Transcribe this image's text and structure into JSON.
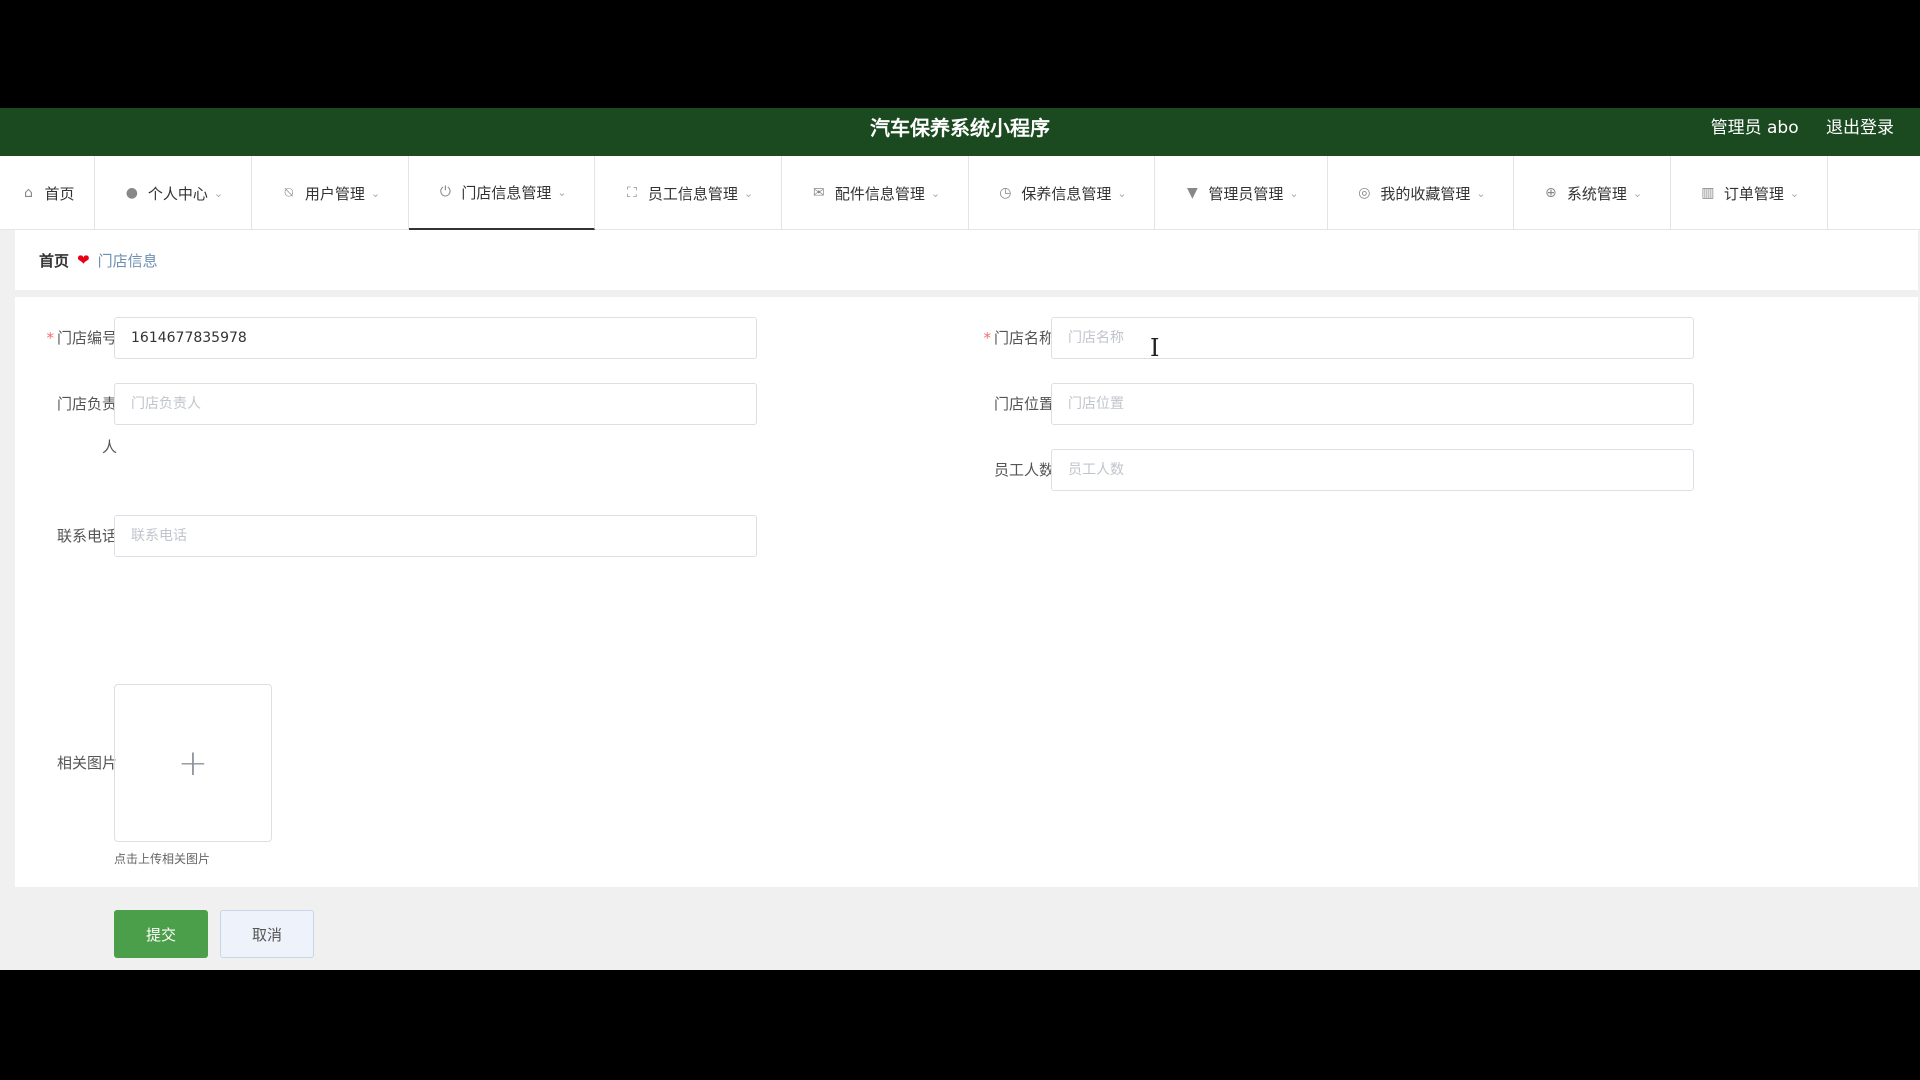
{
  "header": {
    "title": "汽车保养系统小程序",
    "user_label": "管理员 abo",
    "logout_label": "退出登录"
  },
  "nav": {
    "items": [
      {
        "label": "首页",
        "icon": "home-icon",
        "active": false,
        "has_dropdown": false
      },
      {
        "label": "个人中心",
        "icon": "user-icon",
        "active": false,
        "has_dropdown": true
      },
      {
        "label": "用户管理",
        "icon": "bell-off-icon",
        "active": false,
        "has_dropdown": true
      },
      {
        "label": "门店信息管理",
        "icon": "power-icon",
        "active": true,
        "has_dropdown": true
      },
      {
        "label": "员工信息管理",
        "icon": "fullscreen-icon",
        "active": false,
        "has_dropdown": true
      },
      {
        "label": "配件信息管理",
        "icon": "mail-icon",
        "active": false,
        "has_dropdown": true
      },
      {
        "label": "保养信息管理",
        "icon": "clock-icon",
        "active": false,
        "has_dropdown": true
      },
      {
        "label": "管理员管理",
        "icon": "pin-icon",
        "active": false,
        "has_dropdown": true
      },
      {
        "label": "我的收藏管理",
        "icon": "circle-icon",
        "active": false,
        "has_dropdown": true
      },
      {
        "label": "系统管理",
        "icon": "compass-icon",
        "active": false,
        "has_dropdown": true
      },
      {
        "label": "订单管理",
        "icon": "chart-bars-icon",
        "active": false,
        "has_dropdown": true
      }
    ]
  },
  "breadcrumb": {
    "home": "首页",
    "current": "门店信息"
  },
  "form": {
    "store_no": {
      "label": "门店编号",
      "required": true,
      "value": "1614677835978",
      "placeholder": "门店编号"
    },
    "store_name": {
      "label": "门店名称",
      "required": true,
      "value": "",
      "placeholder": "门店名称"
    },
    "manager": {
      "label_line1": "门店负责",
      "label_line2": "人",
      "required": false,
      "value": "",
      "placeholder": "门店负责人"
    },
    "location": {
      "label": "门店位置",
      "required": false,
      "value": "",
      "placeholder": "门店位置"
    },
    "staff_count": {
      "label": "员工人数",
      "required": false,
      "value": "",
      "placeholder": "员工人数"
    },
    "phone": {
      "label": "联系电话",
      "required": false,
      "value": "",
      "placeholder": "联系电话"
    },
    "image": {
      "label": "相关图片",
      "tip": "点击上传相关图片",
      "icon": "plus-icon"
    },
    "submit_label": "提交",
    "cancel_label": "取消"
  },
  "colors": {
    "header_bg": "#1b4a21",
    "submit_bg": "#4c9f4a",
    "required_mark": "#f56c6c",
    "heart": "#e60012"
  }
}
